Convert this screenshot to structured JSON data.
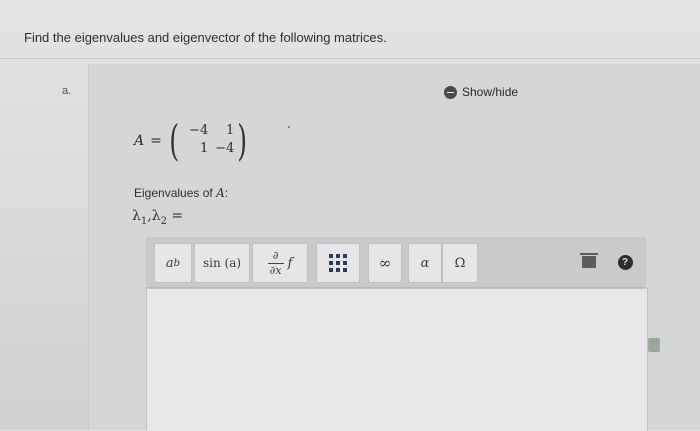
{
  "instruction": "Find the eigenvalues and eigenvector of the following matrices.",
  "part": {
    "label": "a.",
    "toggle_label": "Show/hide"
  },
  "matrix": {
    "name": "A",
    "equals": "=",
    "cells": [
      "−4",
      "1",
      "1",
      "−4"
    ]
  },
  "eigen": {
    "label_prefix": "Eigenvalues of ",
    "label_var": "A",
    "label_suffix": ":",
    "lambda_symbol": "λ",
    "sub1": "1",
    "sub2": "2",
    "separator": ",",
    "equals": "="
  },
  "toolbar": {
    "power_base": "a",
    "power_exp": "b",
    "sin_label": "sin (a)",
    "deriv_num": "∂",
    "deriv_den": "∂x",
    "deriv_f": "f",
    "infinity": "∞",
    "alpha": "α",
    "omega": "Ω",
    "help": "?"
  },
  "icons": {
    "toggle": "collapse-icon",
    "matrix": "matrix-grid-icon",
    "trash": "trash-icon",
    "help": "help-icon",
    "side": "document-icon"
  }
}
